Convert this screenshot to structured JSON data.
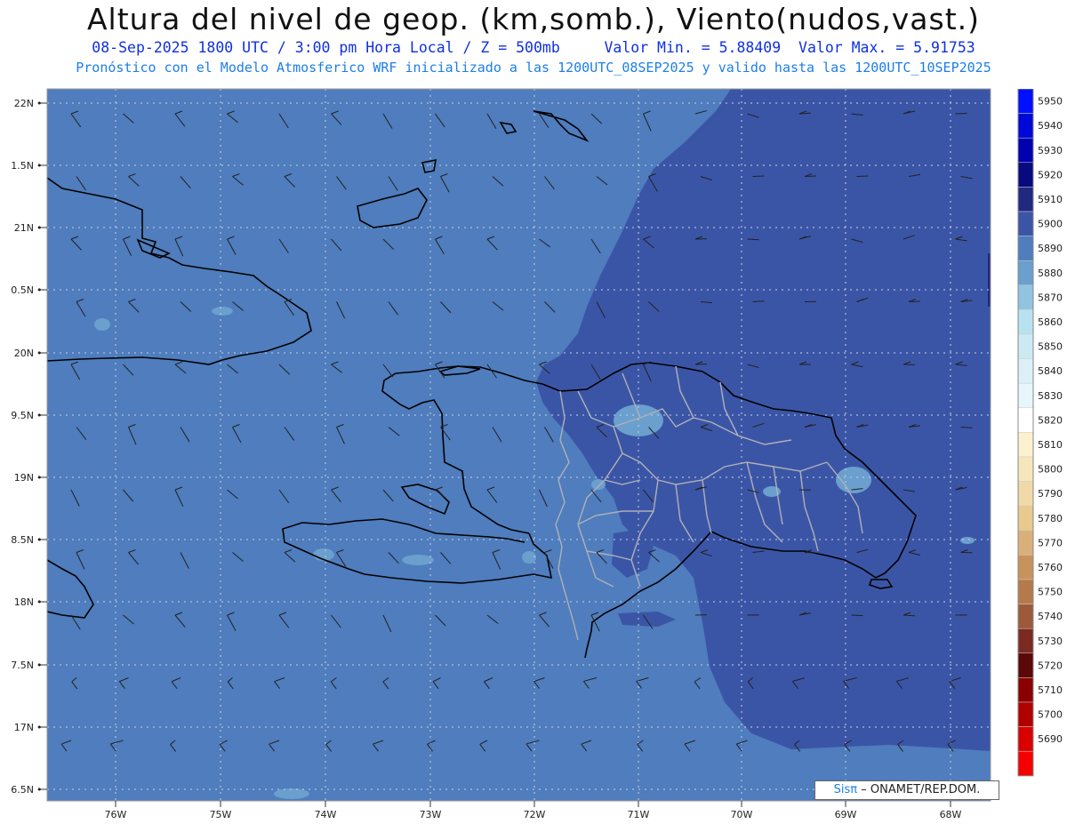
{
  "header": {
    "title": "Altura del nivel de geop. (km,somb.), Viento(nudos,vast.)",
    "date_time": "08-Sep-2025  1800 UTC / 3:00 pm Hora Local / Z = 500mb",
    "value_min": "Valor Min. = 5.88409",
    "value_max": "Valor Max. = 5.91753",
    "forecast": "Pronóstico con el Modelo Atmosferico WRF inicializado a las 1200UTC_08SEP2025 y valido hasta las  1200UTC_10SEP2025"
  },
  "axes": {
    "lat_labels": [
      "22N",
      "1.5N",
      "21N",
      "0.5N",
      "20N",
      "9.5N",
      "19N",
      "8.5N",
      "18N",
      "7.5N",
      "17N",
      "6.5N"
    ],
    "lon_labels": [
      "76W",
      "75W",
      "74W",
      "73W",
      "72W",
      "71W",
      "70W",
      "69W",
      "68W"
    ]
  },
  "legend": {
    "levels": [
      5950,
      5940,
      5930,
      5920,
      5910,
      5900,
      5890,
      5880,
      5870,
      5860,
      5850,
      5840,
      5830,
      5820,
      5810,
      5800,
      5790,
      5780,
      5770,
      5760,
      5750,
      5740,
      5730,
      5720,
      5710,
      5700,
      5690
    ],
    "colors": [
      "#0010ff",
      "#0008d8",
      "#0000b0",
      "#0a0a80",
      "#202880",
      "#3b55a6",
      "#4f7dbd",
      "#6a9fce",
      "#92c4e0",
      "#b8e2ef",
      "#cdeaf3",
      "#dbf1f7",
      "#e6f6fa",
      "#ffffff",
      "#fbf1cf",
      "#f6e6bb",
      "#f0d9a6",
      "#e8c98e",
      "#dab07a",
      "#c8925c",
      "#b57a4b",
      "#9c5a3a",
      "#7a2a20",
      "#5a0808",
      "#8a0000",
      "#b00000",
      "#d80000",
      "#f50000"
    ]
  },
  "map": {
    "shading_colors": {
      "low": "#4f7dbd",
      "high": "#3b55a6",
      "spots": "#6a9fce"
    }
  },
  "credit": {
    "brand": "Sisπ",
    "text": "– ONAMET/REP.DOM."
  }
}
